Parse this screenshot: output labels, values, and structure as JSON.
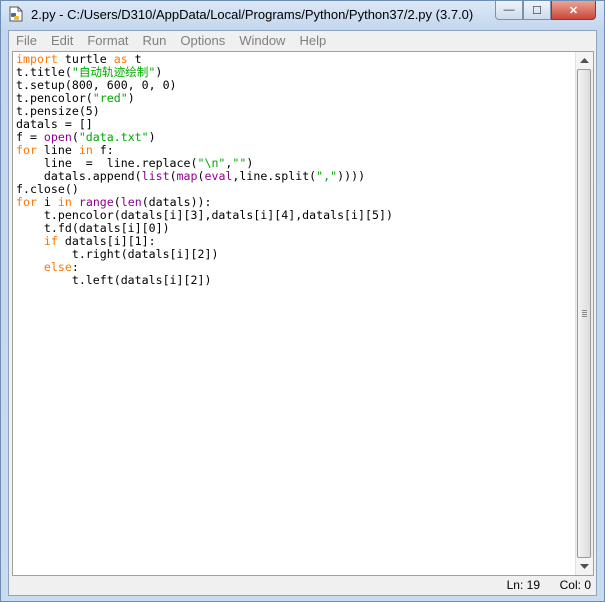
{
  "window": {
    "title": "2.py - C:/Users/D310/AppData/Local/Programs/Python/Python37/2.py (3.7.0)",
    "minimize_label": "—",
    "maximize_label": "☐",
    "close_label": "✕"
  },
  "menu": [
    "File",
    "Edit",
    "Format",
    "Run",
    "Options",
    "Window",
    "Help"
  ],
  "colors": {
    "keyword": "#ff7700",
    "builtin": "#900090",
    "string": "#00aa00",
    "text": "#000000"
  },
  "code_lines": [
    [
      [
        "kw",
        "import"
      ],
      [
        "t",
        " turtle "
      ],
      [
        "kw",
        "as"
      ],
      [
        "t",
        " t"
      ]
    ],
    [
      [
        "t",
        "t.title("
      ],
      [
        "str",
        "\"自动轨迹绘制\""
      ],
      [
        "t",
        ")"
      ]
    ],
    [
      [
        "t",
        "t.setup(800, 600, 0, 0)"
      ]
    ],
    [
      [
        "t",
        "t.pencolor("
      ],
      [
        "str",
        "\"red\""
      ],
      [
        "t",
        ")"
      ]
    ],
    [
      [
        "t",
        "t.pensize(5)"
      ]
    ],
    [
      [
        "t",
        "datals = []"
      ]
    ],
    [
      [
        "t",
        "f = "
      ],
      [
        "bi",
        "open"
      ],
      [
        "t",
        "("
      ],
      [
        "str",
        "\"data.txt\""
      ],
      [
        "t",
        ")"
      ]
    ],
    [
      [
        "kw",
        "for"
      ],
      [
        "t",
        " line "
      ],
      [
        "kw",
        "in"
      ],
      [
        "t",
        " f:"
      ]
    ],
    [
      [
        "t",
        "    line  =  line.replace("
      ],
      [
        "str",
        "\"\\n\""
      ],
      [
        "t",
        ","
      ],
      [
        "str",
        "\"\""
      ],
      [
        "t",
        ")"
      ]
    ],
    [
      [
        "t",
        "    datals.append("
      ],
      [
        "bi",
        "list"
      ],
      [
        "t",
        "("
      ],
      [
        "bi",
        "map"
      ],
      [
        "t",
        "("
      ],
      [
        "bi",
        "eval"
      ],
      [
        "t",
        ",line.split("
      ],
      [
        "str",
        "\",\""
      ],
      [
        "t",
        "))))"
      ]
    ],
    [
      [
        "t",
        "f.close()"
      ]
    ],
    [
      [
        "kw",
        "for"
      ],
      [
        "t",
        " i "
      ],
      [
        "kw",
        "in"
      ],
      [
        "t",
        " "
      ],
      [
        "bi",
        "range"
      ],
      [
        "t",
        "("
      ],
      [
        "bi",
        "len"
      ],
      [
        "t",
        "(datals)):"
      ]
    ],
    [
      [
        "t",
        "    t.pencolor(datals[i][3],datals[i][4],datals[i][5])"
      ]
    ],
    [
      [
        "t",
        "    t.fd(datals[i][0])"
      ]
    ],
    [
      [
        "t",
        "    "
      ],
      [
        "kw",
        "if"
      ],
      [
        "t",
        " datals[i][1]:"
      ]
    ],
    [
      [
        "t",
        "        t.right(datals[i][2])"
      ]
    ],
    [
      [
        "t",
        "    "
      ],
      [
        "kw",
        "else"
      ],
      [
        "t",
        ":"
      ]
    ],
    [
      [
        "t",
        "        t.left(datals[i][2])"
      ]
    ]
  ],
  "status": {
    "line": "Ln: 19",
    "col": "Col: 0"
  }
}
